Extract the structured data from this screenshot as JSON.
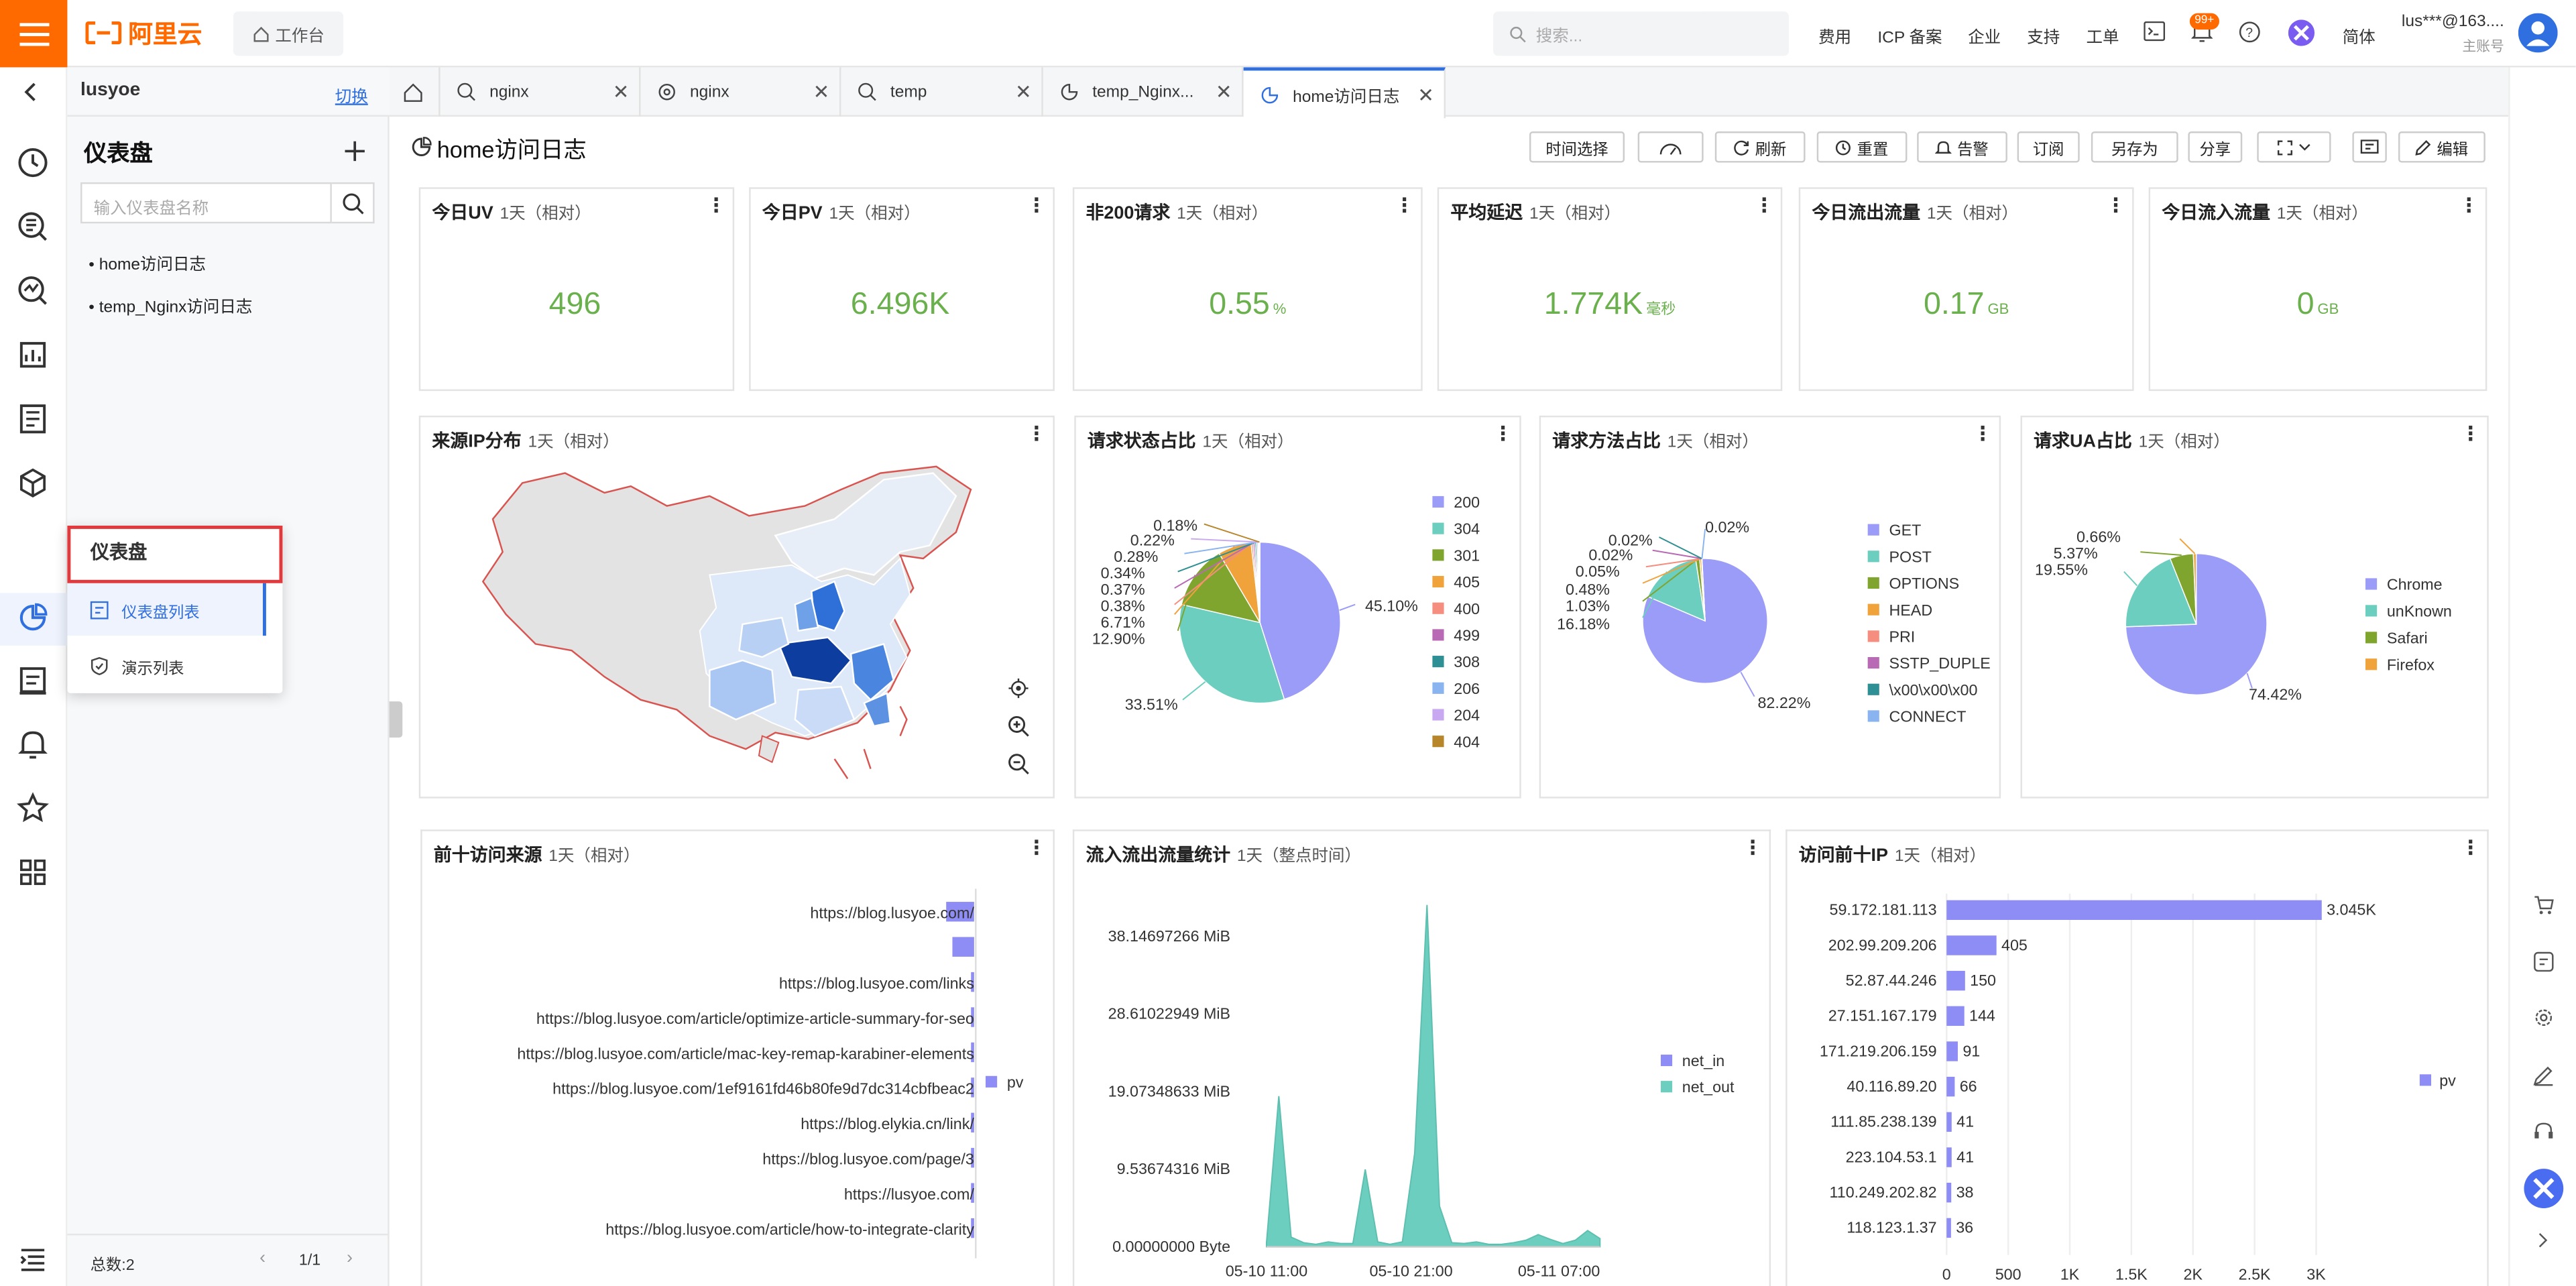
{
  "topbar": {
    "logo": "阿里云",
    "workbench": "工作台",
    "search_placeholder": "搜索...",
    "nav": [
      "费用",
      "ICP 备案",
      "企业",
      "支持",
      "工单"
    ],
    "badge": "99+",
    "lang": "简体",
    "user": "lus***@163....",
    "user_role": "主账号"
  },
  "side": {
    "project": "lusyoe",
    "switch": "切换",
    "title": "仪表盘",
    "filter_placeholder": "输入仪表盘名称",
    "items": [
      "home访问日志",
      "temp_Nginx访问日志"
    ],
    "total": "总数:2",
    "page": "1/1"
  },
  "flyout": {
    "title": "仪表盘",
    "items": [
      "仪表盘列表",
      "演示列表"
    ]
  },
  "tabs": [
    "nginx",
    "nginx",
    "temp",
    "temp_Nginx...",
    "home访问日志"
  ],
  "dashboard": {
    "title": "home访问日志",
    "toolbar": [
      "时间选择",
      "刷新",
      "重置",
      "告警",
      "订阅",
      "另存为",
      "分享",
      "编辑"
    ]
  },
  "kpis": [
    {
      "title": "今日UV",
      "range": "1天（相对）",
      "value": "496",
      "unit": ""
    },
    {
      "title": "今日PV",
      "range": "1天（相对）",
      "value": "6.496K",
      "unit": ""
    },
    {
      "title": "非200请求",
      "range": "1天（相对）",
      "value": "0.55",
      "unit": "%"
    },
    {
      "title": "平均延迟",
      "range": "1天（相对）",
      "value": "1.774K",
      "unit": "毫秒"
    },
    {
      "title": "今日流出流量",
      "range": "1天（相对）",
      "value": "0.17",
      "unit": "GB"
    },
    {
      "title": "今日流入流量",
      "range": "1天（相对）",
      "value": "0",
      "unit": "GB"
    }
  ],
  "panels": {
    "ip_map": {
      "title": "来源IP分布",
      "range": "1天（相对）"
    },
    "status": {
      "title": "请求状态占比",
      "range": "1天（相对）"
    },
    "method": {
      "title": "请求方法占比",
      "range": "1天（相对）"
    },
    "ua": {
      "title": "请求UA占比",
      "range": "1天（相对）"
    },
    "referer": {
      "title": "前十访问来源",
      "range": "1天（相对）"
    },
    "traffic": {
      "title": "流入流出流量统计",
      "range": "1天（整点时间）"
    },
    "topip": {
      "title": "访问前十IP",
      "range": "1天（相对）"
    }
  },
  "chart_data": [
    {
      "id": "status",
      "type": "pie",
      "labels": [
        "200",
        "304",
        "301",
        "405",
        "400",
        "499",
        "308",
        "206",
        "204",
        "404"
      ],
      "values": [
        45.1,
        33.51,
        12.9,
        6.71,
        0.38,
        0.37,
        0.34,
        0.28,
        0.22,
        0.18
      ],
      "value_labels": [
        "45.10%",
        "33.51%",
        "12.90%",
        "6.71%",
        "0.38%",
        "0.37%",
        "0.34%",
        "0.28%",
        "0.22%",
        "0.18%"
      ],
      "colors": [
        "#9b9cf8",
        "#6ccebf",
        "#7fa52e",
        "#f0a23b",
        "#f58e7f",
        "#b96ab4",
        "#2e8f94",
        "#8ab4ef",
        "#c9a8f2",
        "#b8862a"
      ]
    },
    {
      "id": "method",
      "type": "pie",
      "labels": [
        "GET",
        "POST",
        "OPTIONS",
        "HEAD",
        "PRI",
        "SSTP_DUPLE",
        "\\x00\\x00\\x00",
        "CONNECT"
      ],
      "values": [
        82.22,
        16.18,
        1.03,
        0.48,
        0.05,
        0.02,
        0.02,
        0.02
      ],
      "value_labels": [
        "82.22%",
        "16.18%",
        "1.03%",
        "0.48%",
        "0.05%",
        "0.02%",
        "0.02%",
        "0.02%"
      ],
      "colors": [
        "#9b9cf8",
        "#6ccebf",
        "#7fa52e",
        "#f0a23b",
        "#f58e7f",
        "#b96ab4",
        "#2e8f94",
        "#8ab4ef"
      ]
    },
    {
      "id": "ua",
      "type": "pie",
      "labels": [
        "Chrome",
        "unKnown",
        "Safari",
        "Firefox"
      ],
      "values": [
        74.42,
        19.55,
        5.37,
        0.66
      ],
      "value_labels": [
        "74.42%",
        "19.55%",
        "5.37%",
        "0.66%"
      ],
      "colors": [
        "#9b9cf8",
        "#6ccebf",
        "#7fa52e",
        "#f0a23b"
      ]
    },
    {
      "id": "referer",
      "type": "bar",
      "categories": [
        "https://blog.lusyoe.com/",
        "",
        "https://blog.lusyoe.com/links",
        "https://blog.lusyoe.com/article/optimize-article-summary-for-seo",
        "https://blog.lusyoe.com/article/mac-key-remap-karabiner-elements",
        "https://blog.lusyoe.com/1ef9161fd46b80fe9d7dc314cbfbeac2",
        "https://blog.elykia.cn/link/",
        "https://blog.lusyoe.com/page/3",
        "https://lusyoe.com/",
        "https://blog.lusyoe.com/article/how-to-integrate-clarity"
      ],
      "series": [
        {
          "name": "pv",
          "values": [
            9,
            7,
            1,
            1,
            1,
            1,
            1,
            1,
            1,
            1
          ]
        }
      ]
    },
    {
      "id": "traffic",
      "type": "area",
      "x": [
        "05-10 11:00",
        "05-10 21:00",
        "05-11 07:00"
      ],
      "y_ticks": [
        "0.00000000 Byte",
        "9.53674316 MiB",
        "19.07348633 MiB",
        "28.61022949 MiB",
        "38.14697266 MiB"
      ],
      "series": [
        {
          "name": "net_in",
          "values": []
        },
        {
          "name": "net_out",
          "values": [
            0.5,
            18.5,
            1.2,
            0.5,
            0.3,
            0.6,
            0.4,
            0.4,
            9.5,
            0.6,
            0.3,
            0.6,
            11.5,
            42,
            5,
            0.5,
            0.4,
            0.6,
            0.3,
            0.3,
            0.5,
            0.8,
            1.5,
            0.9,
            0.4,
            0.8,
            2.0,
            1.0
          ]
        }
      ],
      "ylim": [
        0,
        44
      ]
    },
    {
      "id": "topip",
      "type": "bar",
      "categories": [
        "59.172.181.113",
        "202.99.209.206",
        "52.87.44.246",
        "27.151.167.179",
        "171.219.206.159",
        "40.116.89.20",
        "111.85.238.139",
        "223.104.53.1",
        "110.249.202.82",
        "118.123.1.37"
      ],
      "series": [
        {
          "name": "pv",
          "values": [
            3045,
            405,
            150,
            144,
            91,
            66,
            41,
            41,
            38,
            36
          ]
        }
      ],
      "value_labels": [
        "3.045K",
        "405",
        "150",
        "144",
        "91",
        "66",
        "41",
        "41",
        "38",
        "36"
      ],
      "x_ticks": [
        "0",
        "500",
        "1K",
        "1.5K",
        "2K",
        "2.5K",
        "3K"
      ],
      "xlim": [
        0,
        3200
      ]
    }
  ]
}
